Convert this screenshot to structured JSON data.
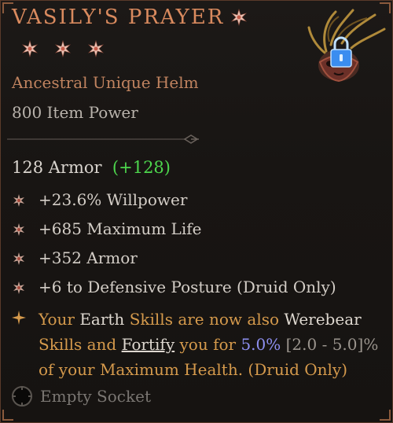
{
  "item": {
    "name": "VASILY'S PRAYER",
    "type": "Ancestral Unique Helm",
    "power": "800 Item Power",
    "armor_value": "128 Armor",
    "armor_bonus": "(+128)",
    "locked": true
  },
  "affixes": [
    {
      "text": "+23.6% Willpower"
    },
    {
      "text": "+685 Maximum Life"
    },
    {
      "text": "+352 Armor"
    },
    {
      "text": "+6 to Defensive Posture (Druid Only)"
    }
  ],
  "aspect": {
    "p1": "Your ",
    "earth": "Earth",
    "p2": " ",
    "skills1": "Skills",
    "p3": " are now also ",
    "werebear": "Werebear",
    "p4": " Skills and ",
    "fortify": "Fortify",
    "p5": " you for ",
    "value": "5.0%",
    "p6": " ",
    "range": "[2.0 - 5.0]",
    "p7": "%",
    "p8": " of your Maximum Health. (Druid Only)"
  },
  "socket": {
    "label": "Empty Socket"
  },
  "colors": {
    "title": "#d98a5e",
    "unique_orange": "#d59a4c",
    "bonus_green": "#4dd64d",
    "value_blue": "#8d8ff0",
    "background": "#181513"
  },
  "icons": {
    "title_star": "unique-star-icon",
    "rarity_stars": [
      "rarity-star-icon",
      "rarity-star-icon",
      "rarity-star-icon"
    ],
    "affix_bullet": "affix-star-icon",
    "aspect_bullet": "aspect-star-icon",
    "lock": "lock-icon",
    "socket": "empty-socket-icon"
  }
}
